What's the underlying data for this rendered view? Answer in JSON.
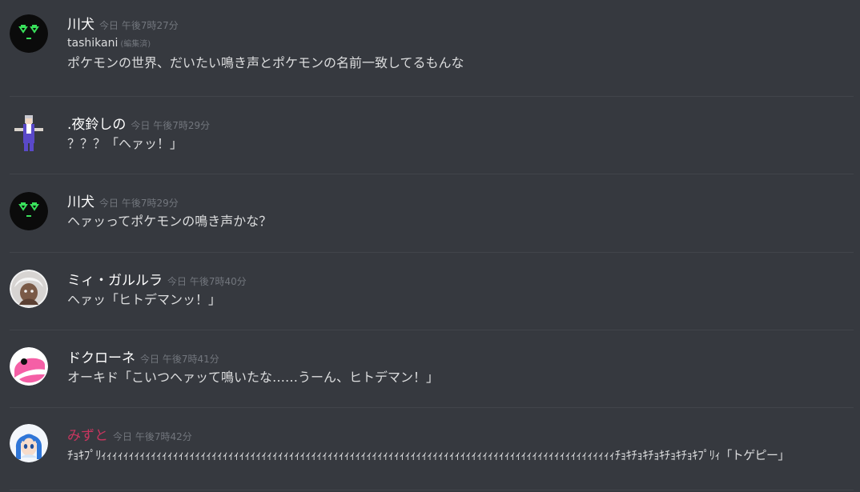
{
  "messages": [
    {
      "author": "川犬",
      "timestamp": "今日 午後7時27分",
      "lines": [
        {
          "text": "tashikani",
          "edited": "(編集済)"
        },
        {
          "text": "ポケモンの世界、だいたい鳴き声とポケモンの名前一致してるもんな"
        }
      ],
      "avatar": "green-face-avatar"
    },
    {
      "author": ".夜鈴しの",
      "timestamp": "今日 午後7時29分",
      "lines": [
        {
          "text": "？？？「ヘァッ！」"
        }
      ],
      "avatar": "pixel-character-avatar"
    },
    {
      "author": "川犬",
      "timestamp": "今日 午後7時29分",
      "lines": [
        {
          "text": "ヘァッってポケモンの鳴き声かな？"
        }
      ],
      "avatar": "green-face-avatar"
    },
    {
      "author": "ミィ・ガルルラ",
      "timestamp": "今日 午後7時40分",
      "lines": [
        {
          "text": "ヘァッ「ヒトデマンッ！」"
        }
      ],
      "avatar": "anime-character-avatar"
    },
    {
      "author": "ドクローネ",
      "timestamp": "今日 午後7時41分",
      "lines": [
        {
          "text": "オーキド「こいつヘァッて鳴いたな……うーん、ヒトデマン！」"
        }
      ],
      "avatar": "pink-creature-avatar"
    },
    {
      "author": "みずと",
      "timestamp": "今日 午後7時42分",
      "lines": [
        {
          "text": "ﾁｮｷﾌﾟﾘｨｨｨｨｨｨｨｨｨｨｨｨｨｨｨｨｨｨｨｨｨｨｨｨｨｨｨｨｨｨｨｨｨｨｨｨｨｨｨｨｨｨｨｨｨｨｨｨｨｨｨｨｨｨｨｨｨｨｨｨｨｨｨｨｨｨｨｨｨｨｨｨｨｨｨｨｨｨｨｨｨｨｨｨｨｨｨｨｨｨｨｨｨﾁｮｷﾁｮｷﾁｮｷﾁｮｷﾁｮｷﾌﾟﾘｨ「トゲピー」"
        }
      ],
      "avatar": "blue-hair-avatar",
      "author_color": "#c7365f"
    }
  ]
}
